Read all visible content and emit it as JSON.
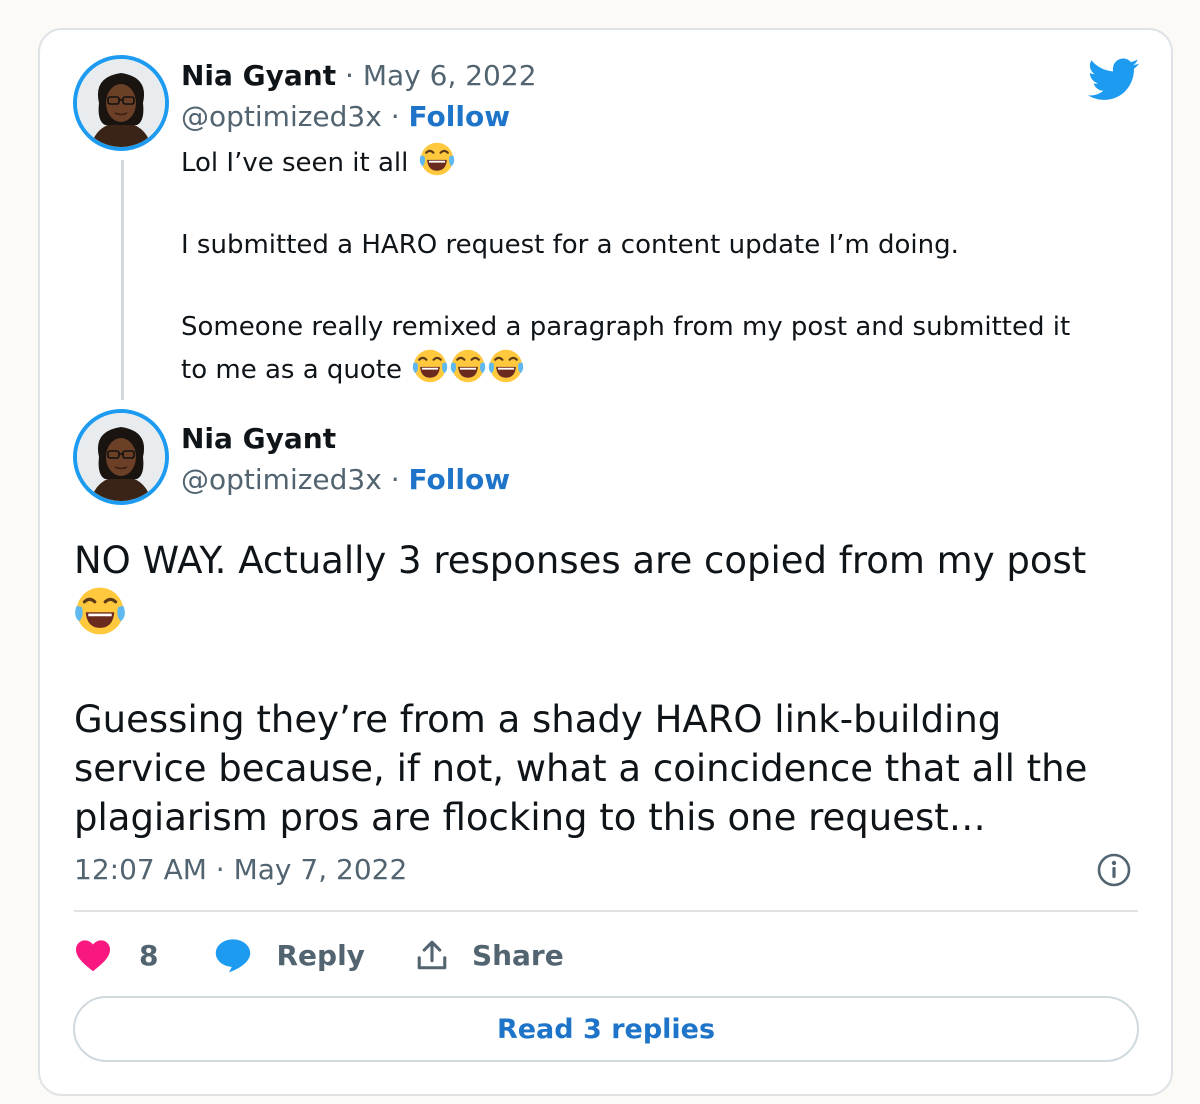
{
  "tweet1": {
    "author_name": "Nia Gyant",
    "separator": "·",
    "date": "May 6, 2022",
    "handle": "@optimized3x",
    "follow_label": "Follow",
    "lines": [
      "Lol I’ve seen it all",
      "I submitted a HARO request for a content update I’m doing.",
      "Someone really remixed a paragraph from my post and submitted it",
      "to me as a quote"
    ],
    "line1_emoji": "face-with-tears-of-joy",
    "last_line_emoji_count": 3
  },
  "tweet2": {
    "author_name": "Nia Gyant",
    "handle": "@optimized3x",
    "separator": "·",
    "follow_label": "Follow",
    "paragraph1": "NO WAY. Actually 3 responses are copied from my post",
    "paragraph2": "Guessing they’re from a shady HARO link-building service because, if not, what a coincidence that all the plagiarism pros are flocking to this one request…",
    "timestamp": "12:07 AM · May 7, 2022"
  },
  "actions": {
    "like_count": "8",
    "reply_label": "Reply",
    "share_label": "Share"
  },
  "read_replies_label": "Read 3 replies",
  "icons": {
    "brand": "twitter-bird-icon",
    "info": "info-icon",
    "like": "heart-icon",
    "reply": "speech-bubble-icon",
    "share": "share-upload-icon"
  },
  "colors": {
    "brand_blue": "#1d9bf0",
    "link_blue": "#1d74c8",
    "like_pink": "#f91880",
    "muted_text": "#536471",
    "border": "#dfe3e6"
  }
}
